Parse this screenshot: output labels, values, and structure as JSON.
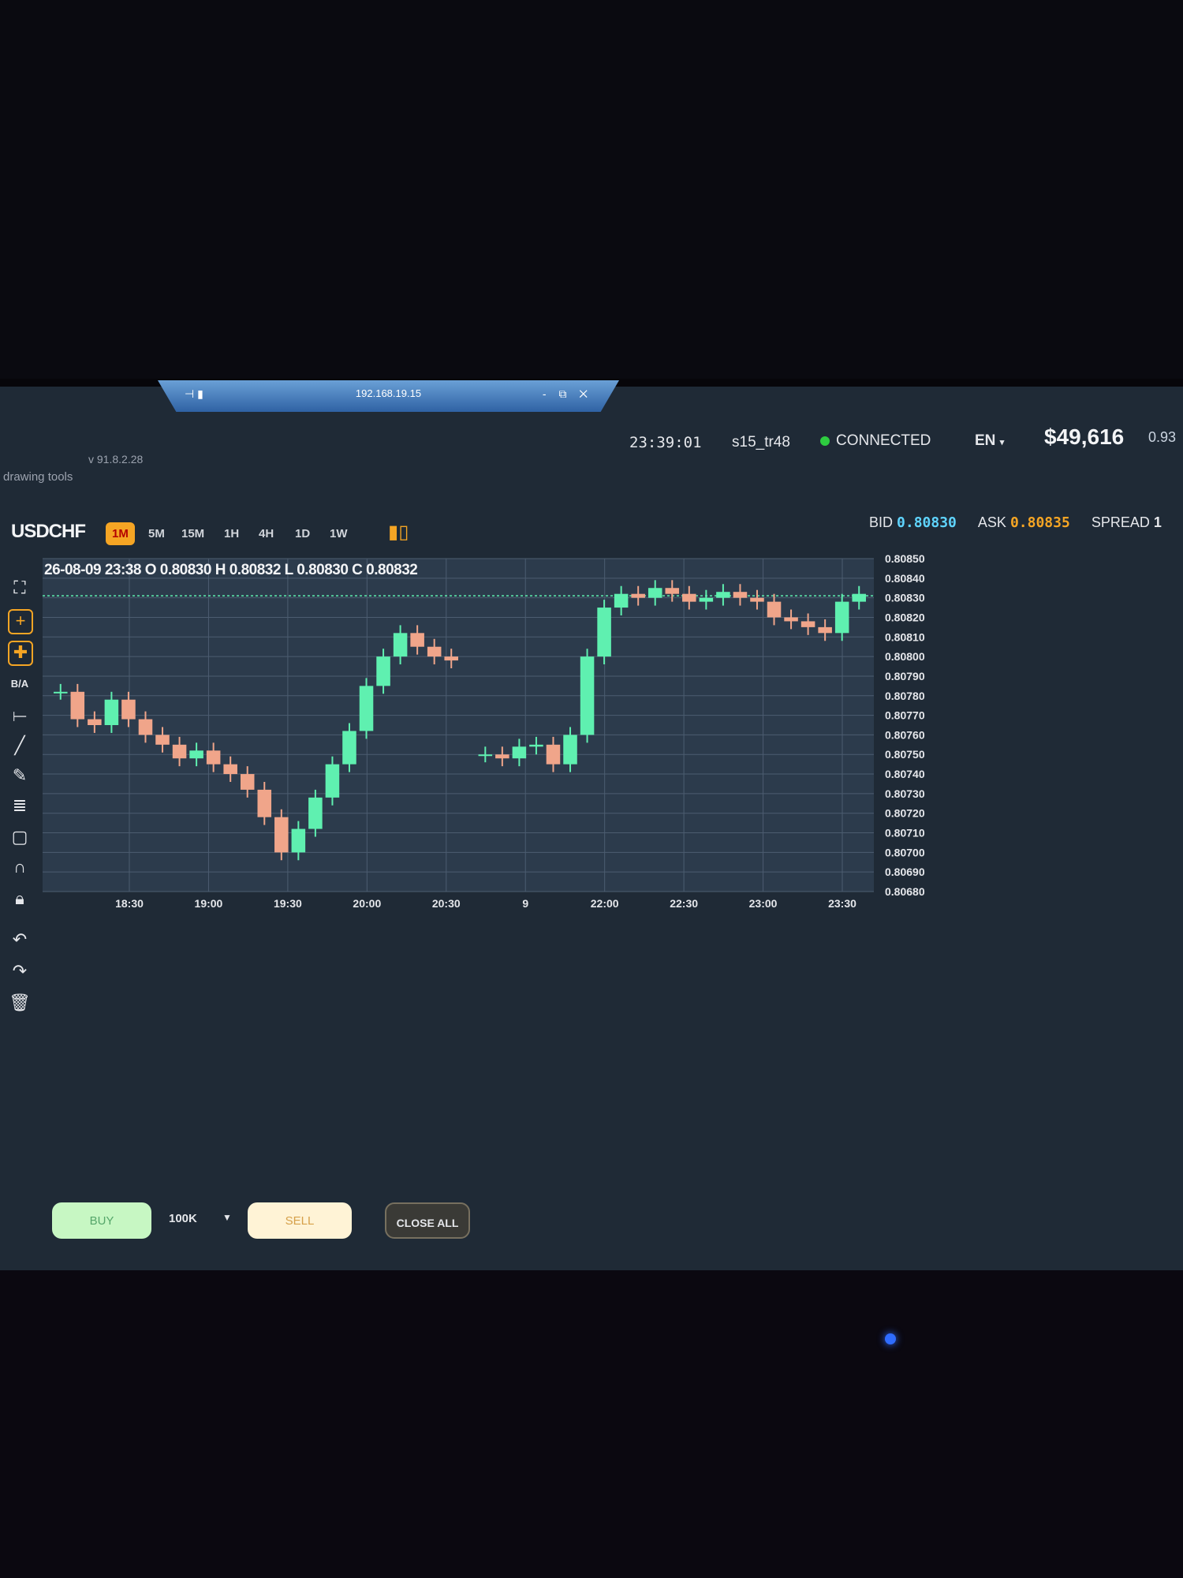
{
  "window": {
    "remote_address": "192.168.19.15",
    "controls": "- ⧉ ✕"
  },
  "header": {
    "clock": "23:39:01",
    "account": "s15_tr48",
    "status": "CONNECTED",
    "language": "EN",
    "balance": "$49,616",
    "extra_value": "0.93",
    "version": "v 91.8.2.28",
    "drawing_tools_label": "drawing tools"
  },
  "symbol_bar": {
    "symbol": "USDCHF",
    "timeframes": [
      "1M",
      "5M",
      "15M",
      "1H",
      "4H",
      "1D",
      "1W"
    ],
    "active_timeframe": "1M",
    "bid_label": "BID",
    "bid": "0.80830",
    "ask_label": "ASK",
    "ask": "0.80835",
    "spread_label": "SPREAD",
    "spread": "1"
  },
  "ohlc_readout": "26-08-09 23:38 O 0.80830 H 0.80832 L 0.80830 C 0.80832",
  "toolbar": {
    "ba_label": "B/A",
    "icons": [
      "fullscreen-icon",
      "crosshair-icon",
      "crosshair-add-icon",
      "horizontal-line-icon",
      "trend-line-icon",
      "pencil-icon",
      "fib-lines-icon",
      "rectangle-icon",
      "magnet-icon",
      "lock-icon",
      "undo-icon",
      "redo-icon",
      "trash-icon"
    ]
  },
  "trading_bar": {
    "buy_label": "BUY",
    "quantity": "100K",
    "sell_label": "SELL",
    "close_all_label": "CLOSE ALL"
  },
  "colors": {
    "bull": "#5ff0b0",
    "bear": "#f0a58a",
    "accent": "#f5a524",
    "bid": "#5fd4ff"
  },
  "chart_data": {
    "type": "line",
    "series": [
      {
        "x": [
          "18:13",
          "18:20",
          "18:27",
          "18:34",
          "18:41",
          "18:48",
          "18:55",
          "19:02",
          "19:09",
          "19:16",
          "19:23",
          "19:30",
          "19:37",
          "19:44",
          "19:51",
          "19:58",
          "20:05",
          "20:12",
          "20:19",
          "20:26",
          "20:33",
          "20:40",
          "20:47",
          "20:54",
          "21:01",
          "21:08",
          "21:15",
          "21:22",
          "21:29",
          "21:36",
          "21:43",
          "21:50",
          "21:57",
          "22:04",
          "22:11",
          "22:18",
          "22:25",
          "22:32",
          "22:39",
          "22:46",
          "22:53",
          "23:00",
          "23:07",
          "23:14",
          "23:21",
          "23:28",
          "23:35",
          "23:38"
        ],
        "values": [
          0.80782,
          0.80768,
          0.80765,
          0.80778,
          0.80768,
          0.8076,
          0.80755,
          0.80748,
          0.80752,
          0.80745,
          0.8074,
          0.80732,
          0.80718,
          0.807,
          0.80712,
          0.80728,
          0.80745,
          0.80762,
          0.80785,
          0.808,
          0.80812,
          0.80805,
          0.808,
          0.80798,
          null,
          0.8075,
          0.80748,
          0.80754,
          0.80755,
          0.80745,
          0.8076,
          0.808,
          0.80825,
          0.80832,
          0.8083,
          0.80835,
          0.80832,
          0.80828,
          0.8083,
          0.80833,
          0.8083,
          0.80828,
          0.8082,
          0.80818,
          0.80815,
          0.80812,
          0.80828,
          0.80832
        ]
      }
    ],
    "x_ticks": [
      "18:30",
      "19:00",
      "19:30",
      "20:00",
      "20:30",
      "9",
      "22:00",
      "22:30",
      "23:00",
      "23:30"
    ],
    "y_ticks": [
      "0.80850",
      "0.80840",
      "0.80830",
      "0.80820",
      "0.80810",
      "0.80800",
      "0.80790",
      "0.80780",
      "0.80770",
      "0.80760",
      "0.80750",
      "0.80740",
      "0.80730",
      "0.80720",
      "0.80710",
      "0.80700",
      "0.80690",
      "0.80680"
    ],
    "ylim": [
      0.8068,
      0.8085
    ],
    "current_price": 0.80831,
    "grid": true
  }
}
